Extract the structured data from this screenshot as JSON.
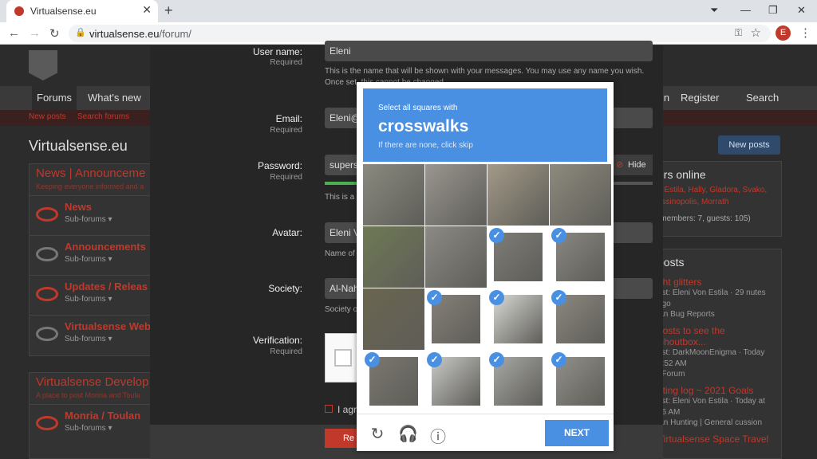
{
  "browser": {
    "tab_title": "Virtualsense.eu",
    "url_host": "virtualsense.eu",
    "url_path": "/forum/",
    "profile_initial": "E"
  },
  "forum": {
    "nav": [
      "Forums",
      "What's new",
      "in",
      "Register",
      "Search"
    ],
    "subnav": [
      "New posts",
      "Search forums"
    ],
    "title": "Virtualsense.eu",
    "new_posts_btn": "New posts",
    "block1": {
      "title": "News | Announceme",
      "sub": "Keeping everyone informed and a",
      "nodes": [
        {
          "title": "News",
          "sub": "Sub-forums ▾"
        },
        {
          "title": "Announcements",
          "sub": "Sub-forums ▾"
        },
        {
          "title": "Updates / Releas",
          "sub": "Sub-forums ▾"
        },
        {
          "title": "Virtualsense Webs",
          "sub": "Sub-forums ▾"
        }
      ]
    },
    "block2": {
      "title": "Virtualsense Develop",
      "sub": "A place to post Monria and Toula",
      "nodes": [
        {
          "title": "Monria / Toulan",
          "sub": "Sub-forums ▾"
        }
      ]
    },
    "right1": {
      "title": "ers online",
      "names": "n Estila, Hally, Gladora, Svako, essinopolis, Morrath",
      "members": "(members: 7, guests: 105)"
    },
    "right2": {
      "title": "posts",
      "items": [
        {
          "t": "ght glitters",
          "m": "est: Eleni Von Estila · 29 nutes ago",
          "f": "lan Bug Reports"
        },
        {
          "t": "posts to see the Shoutbox...",
          "m": "est: DarkMoonEnigma · Today 2:52 AM",
          "f": "t Forum"
        },
        {
          "t": "nting log ~ 2021 Goals",
          "m": "est: Eleni Von Estila · Today at 26 AM",
          "f": "lan Hunting | General cussion"
        },
        {
          "t": "Virtualsense Space Travel",
          "m": "",
          "f": ""
        }
      ]
    }
  },
  "modal": {
    "username": {
      "label": "User name:",
      "req": "Required",
      "value": "Eleni",
      "hint": "This is the name that will be shown with your messages. You may use any name you wish. Once set, this cannot be changed."
    },
    "email": {
      "label": "Email:",
      "req": "Required",
      "value": "Eleni@"
    },
    "password": {
      "label": "Password:",
      "req": "Required",
      "value": "supers",
      "hide": "Hide",
      "hint": "This is a r"
    },
    "avatar": {
      "label": "Avatar:",
      "value": "Eleni V",
      "hint": "Name of"
    },
    "society": {
      "label": "Society:",
      "value": "Al-Nah",
      "hint": "Society o"
    },
    "verification": {
      "label": "Verification:",
      "req": "Required"
    },
    "agree": "I agr",
    "register_btn": "Re"
  },
  "captcha": {
    "line1": "Select all squares with",
    "line2": "crosswalks",
    "line3": "If there are none, click skip",
    "next": "NEXT",
    "selected": [
      false,
      false,
      false,
      false,
      false,
      false,
      true,
      true,
      false,
      true,
      true,
      true,
      true,
      true,
      true,
      true
    ]
  }
}
